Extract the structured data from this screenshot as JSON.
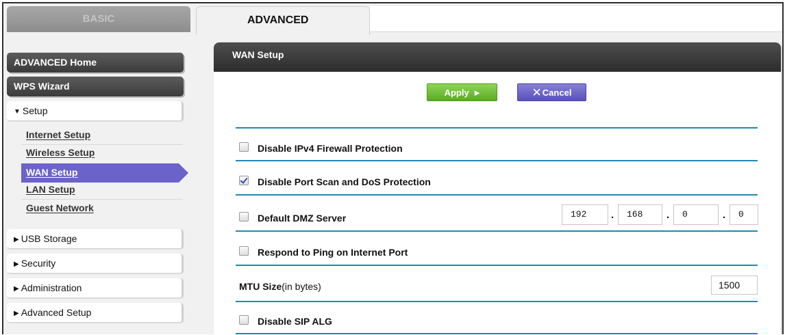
{
  "tabs": {
    "basic": "BASIC",
    "advanced": "ADVANCED"
  },
  "nav": {
    "advanced_home": "ADVANCED Home",
    "wps_wizard": "WPS Wizard",
    "setup": "Setup",
    "setup_items": [
      "Internet Setup",
      "Wireless Setup",
      "WAN Setup",
      "LAN Setup",
      "Guest Network"
    ],
    "usb_storage": "USB Storage",
    "security": "Security",
    "administration": "Administration",
    "advanced_setup": "Advanced Setup"
  },
  "panel": {
    "title": "WAN Setup",
    "apply_label": "Apply",
    "cancel_label": "Cancel"
  },
  "settings": {
    "disable_ipv4_firewall": {
      "label": "Disable IPv4 Firewall Protection",
      "checked": false
    },
    "disable_port_scan": {
      "label": "Disable Port Scan and DoS Protection",
      "checked": true
    },
    "default_dmz": {
      "label": "Default DMZ Server",
      "checked": false,
      "ip": [
        "192",
        "168",
        "0",
        "0"
      ]
    },
    "respond_ping": {
      "label": "Respond to Ping on Internet Port",
      "checked": false
    },
    "mtu": {
      "label": "MTU Size",
      "unit": "(in bytes)",
      "value": "1500"
    },
    "disable_sip_alg": {
      "label": "Disable SIP ALG",
      "checked": false
    }
  },
  "colors": {
    "accent_rule": "#1d8ab0",
    "active_nav": "#6b63c9",
    "apply_green": "#6fbf3a",
    "cancel_purple": "#6c65c8"
  }
}
